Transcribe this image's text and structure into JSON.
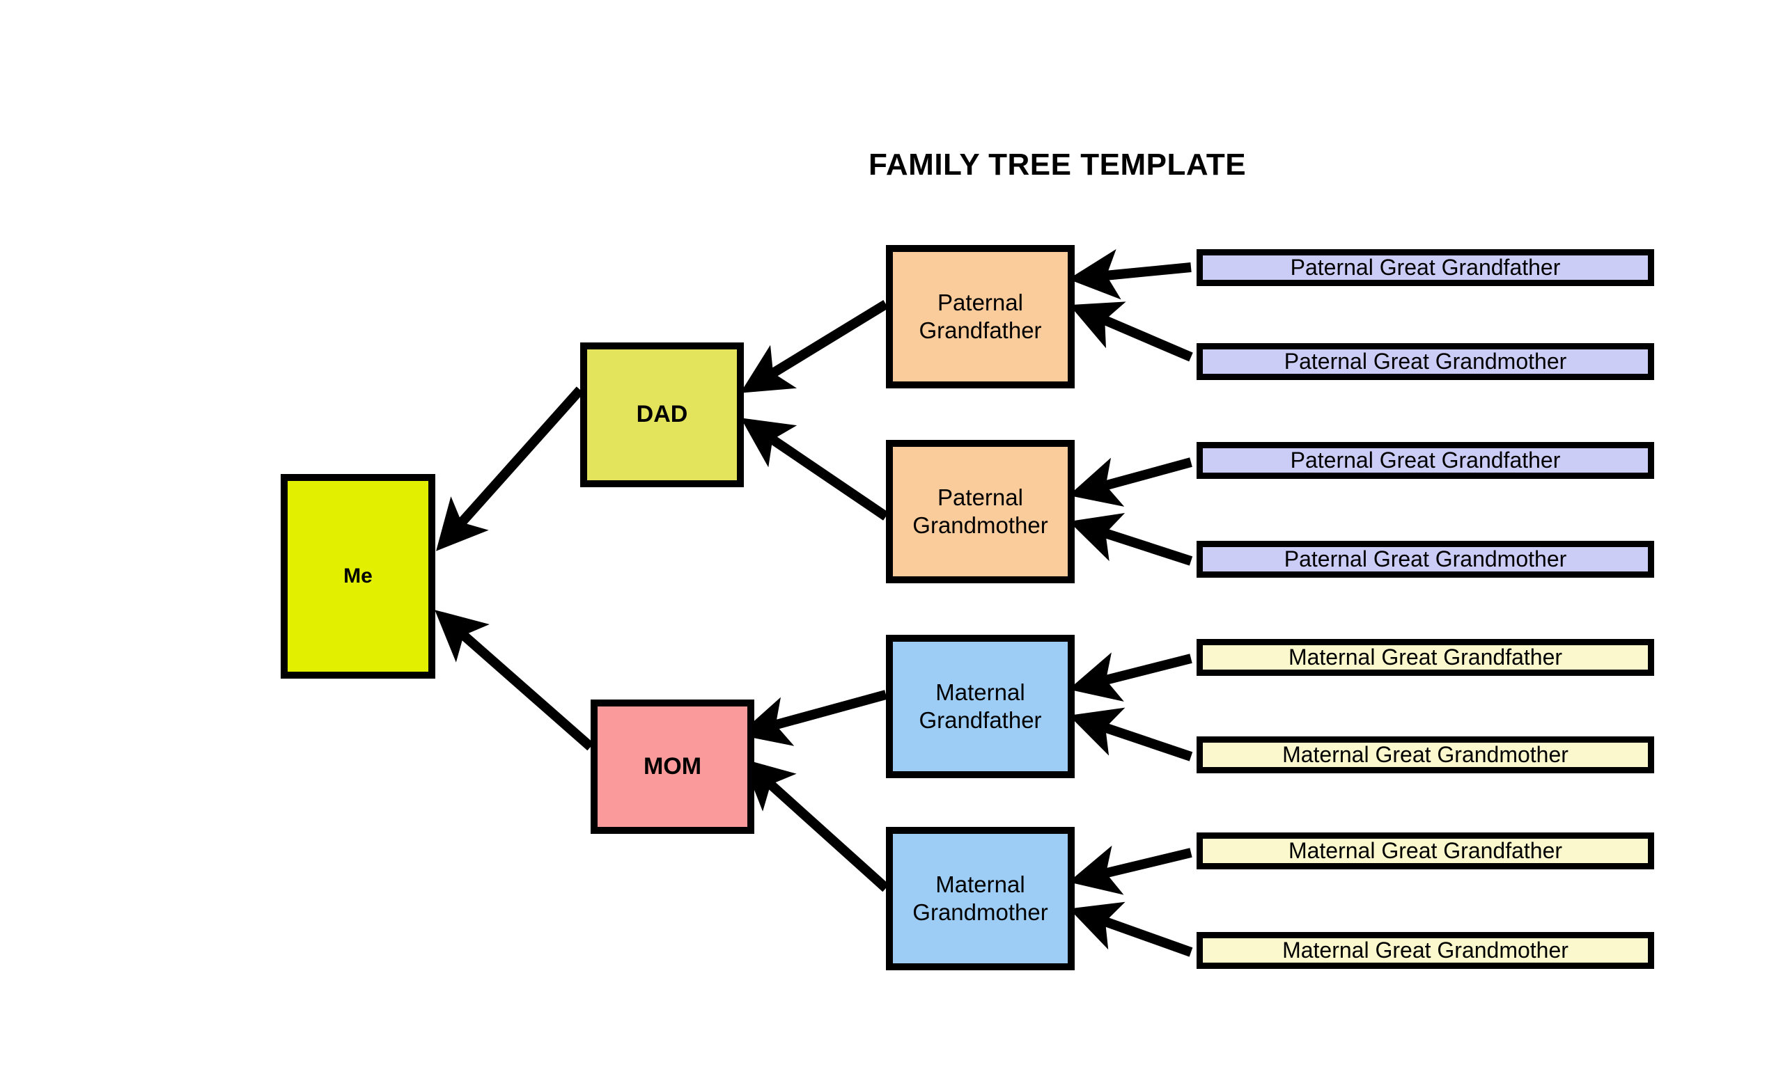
{
  "title": "FAMILY TREE TEMPLATE",
  "colors": {
    "self": "#e2f000",
    "dad": "#e3e35c",
    "mom": "#fa9a9a",
    "paternal_grandparent": "#fbcc9b",
    "maternal_grandparent": "#9dcdf5",
    "paternal_great_grandparent": "#cccdf7",
    "maternal_great_grandparent": "#faf8cc",
    "outline": "#000000",
    "background": "#ffffff",
    "text": "#000000"
  },
  "nodes": {
    "self": {
      "label": "Me"
    },
    "dad": {
      "label": "DAD"
    },
    "mom": {
      "label": "MOM"
    },
    "paternal_grandfather": {
      "label": "Paternal Grandfather"
    },
    "paternal_grandmother": {
      "label": "Paternal Grandmother"
    },
    "maternal_grandfather": {
      "label": "Maternal Grandfather"
    },
    "maternal_grandmother": {
      "label": "Maternal Grandmother"
    },
    "pgf_father": {
      "label": "Paternal Great Grandfather"
    },
    "pgf_mother": {
      "label": "Paternal Great Grandmother"
    },
    "pgm_father": {
      "label": "Paternal Great Grandfather"
    },
    "pgm_mother": {
      "label": "Paternal Great Grandmother"
    },
    "mgf_father": {
      "label": "Maternal Great Grandfather"
    },
    "mgf_mother": {
      "label": "Maternal Great Grandmother"
    },
    "mgm_father": {
      "label": "Maternal Great Grandfather"
    },
    "mgm_mother": {
      "label": "Maternal Great Grandmother"
    }
  },
  "relationships": [
    {
      "from": "dad",
      "to": "self"
    },
    {
      "from": "mom",
      "to": "self"
    },
    {
      "from": "paternal_grandfather",
      "to": "dad"
    },
    {
      "from": "paternal_grandmother",
      "to": "dad"
    },
    {
      "from": "maternal_grandfather",
      "to": "mom"
    },
    {
      "from": "maternal_grandmother",
      "to": "mom"
    },
    {
      "from": "pgf_father",
      "to": "paternal_grandfather"
    },
    {
      "from": "pgf_mother",
      "to": "paternal_grandfather"
    },
    {
      "from": "pgm_father",
      "to": "paternal_grandmother"
    },
    {
      "from": "pgm_mother",
      "to": "paternal_grandmother"
    },
    {
      "from": "mgf_father",
      "to": "maternal_grandfather"
    },
    {
      "from": "mgf_mother",
      "to": "maternal_grandfather"
    },
    {
      "from": "mgm_father",
      "to": "maternal_grandmother"
    },
    {
      "from": "mgm_mother",
      "to": "maternal_grandmother"
    }
  ]
}
